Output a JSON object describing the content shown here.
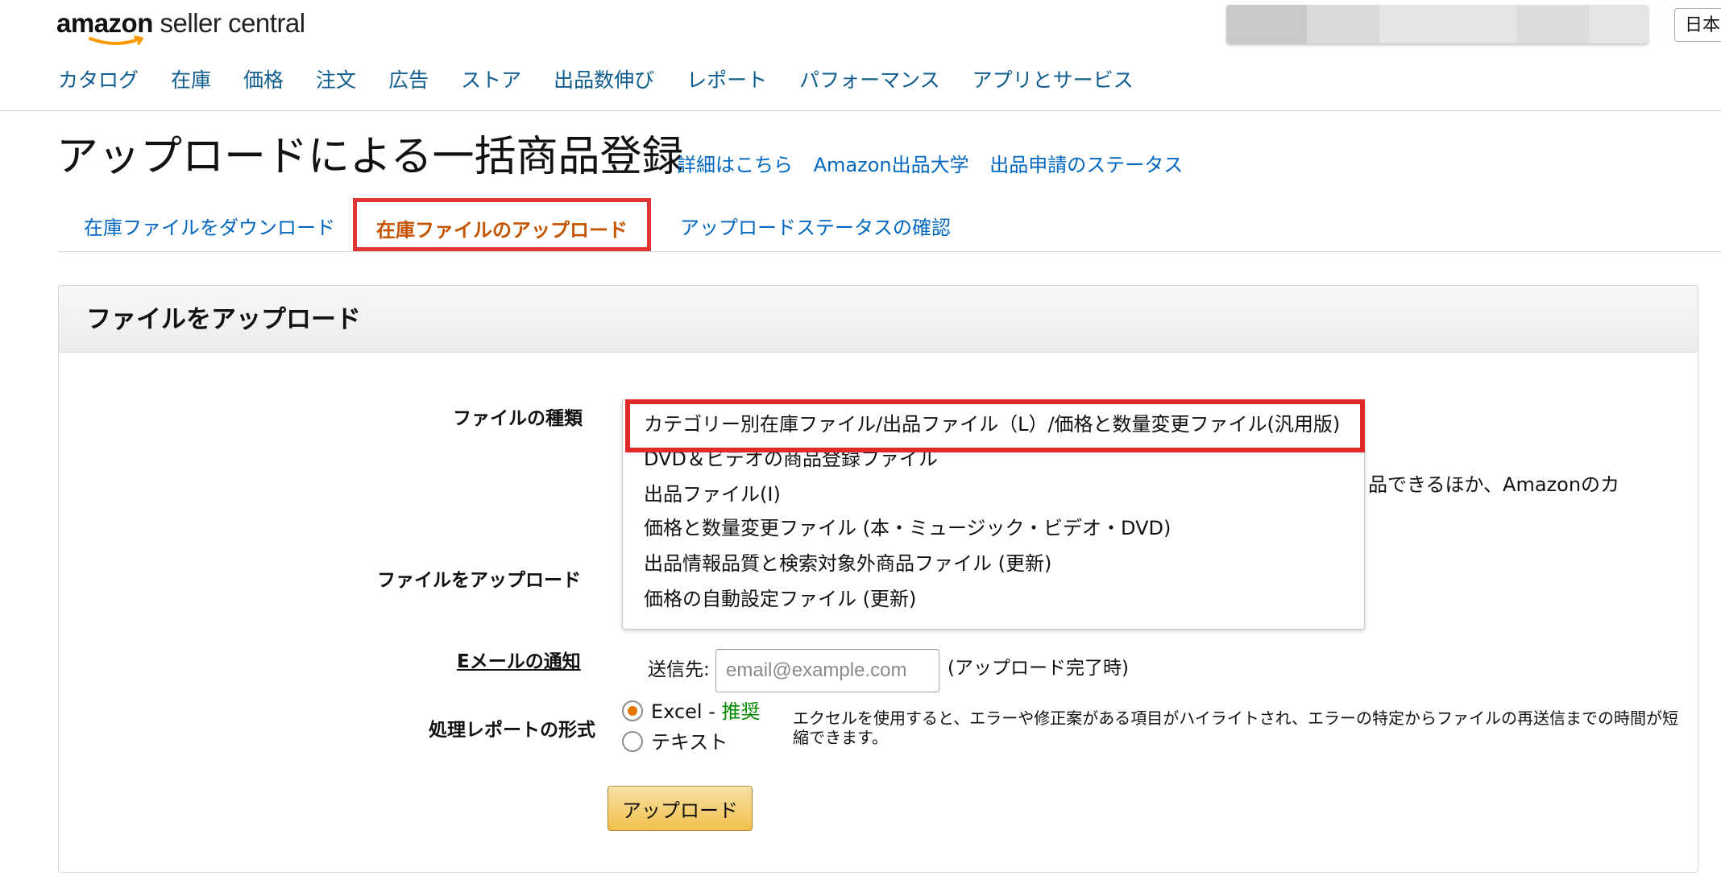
{
  "header": {
    "logo_brand": "amazon",
    "logo_rest": " seller central",
    "lang_label": "日本",
    "nav": [
      {
        "label": "カタログ"
      },
      {
        "label": "在庫"
      },
      {
        "label": "価格"
      },
      {
        "label": "注文"
      },
      {
        "label": "広告"
      },
      {
        "label": "ストア"
      },
      {
        "label": "出品数伸び"
      },
      {
        "label": "レポート"
      },
      {
        "label": "パフォーマンス"
      },
      {
        "label": "アプリとサービス"
      }
    ]
  },
  "page": {
    "title": "アップロードによる一括商品登録",
    "links": [
      "詳細はこちら",
      "Amazon出品大学",
      "出品申請のステータス"
    ]
  },
  "tabs": {
    "download": "在庫ファイルをダウンロード",
    "upload": "在庫ファイルのアップロード",
    "status": "アップロードステータスの確認"
  },
  "panel": {
    "title": "ファイルをアップロード",
    "file_type_label": "ファイルの種類",
    "file_upload_label": "ファイルをアップロード",
    "email_label": "Eメールの通知",
    "report_format_label": "処理レポートの形式",
    "file_type_options": [
      "カテゴリー別在庫ファイル/出品ファイル（L）/価格と数量変更ファイル(汎用版)",
      "DVD＆ビデオの商品登録ファイル",
      "出品ファイル(I)",
      "価格と数量変更ファイル (本・ミュージック・ビデオ・DVD)",
      "出品情報品質と検索対象外商品ファイル (更新)",
      "価格の自動設定ファイル (更新)"
    ],
    "hidden_description": "品できるほか、Amazonのカ",
    "email": {
      "prefix": "送信先:",
      "placeholder": "email@example.com",
      "value": "",
      "suffix": "(アップロード完了時)"
    },
    "report_format": {
      "excel_label": "Excel - ",
      "excel_recommended": "推奨",
      "text_label": "テキスト",
      "selected": "excel",
      "note": "エクセルを使用すると、エラーや修正案がある項目がハイライトされ、エラーの特定からファイルの再送信までの時間が短縮できます。"
    },
    "upload_button": "アップロード"
  },
  "colors": {
    "link": "#0066c0",
    "active_tab": "#c45500",
    "highlight_box": "#e02828",
    "button": "#f0c14b",
    "radio_checked": "#e77600",
    "recommended": "#008a00"
  }
}
